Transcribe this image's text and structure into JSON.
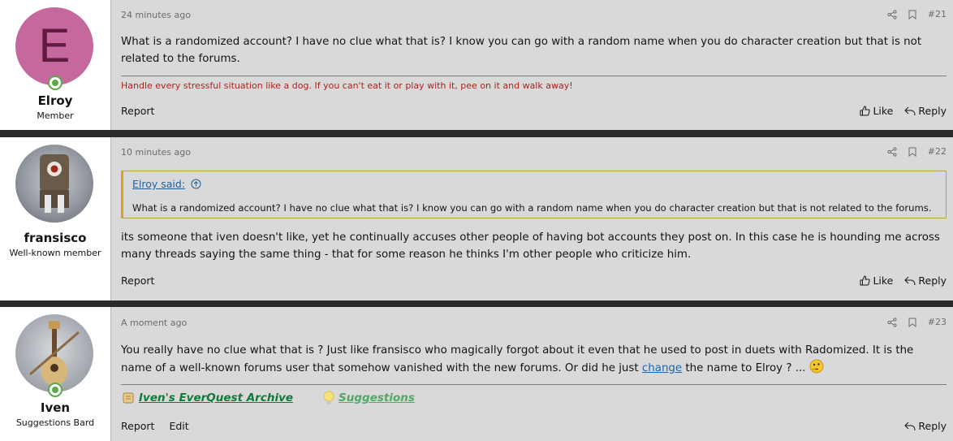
{
  "posts": [
    {
      "author": "Elroy",
      "author_title": "Member",
      "avatar_letter": "E",
      "time": "24 minutes ago",
      "number": "#21",
      "message": "What is a randomized account? I have no clue what that is? I know you can go with a random name when you do character creation but that is not related to the forums.",
      "signature": "Handle every stressful situation like a dog. If you can't eat it or play with it, pee on it and walk away!",
      "actions": {
        "report": "Report",
        "like": "Like",
        "reply": "Reply"
      }
    },
    {
      "author": "fransisco",
      "author_title": "Well-known member",
      "time": "10 minutes ago",
      "number": "#22",
      "quote_author": "Elroy said:",
      "quote_text": "What is a randomized account? I have no clue what that is? I know you can go with a random name when you do character creation but that is not related to the forums.",
      "message": "its someone that iven doesn't like, yet he continually accuses other people of having bot accounts they post on. In this case he is hounding me across many threads saying the same thing - that for some reason he thinks I'm other people who criticize him.",
      "actions": {
        "report": "Report",
        "like": "Like",
        "reply": "Reply"
      }
    },
    {
      "author": "Iven",
      "author_title": "Suggestions Bard",
      "time": "A moment ago",
      "number": "#23",
      "message_before_link": "You really have no clue what that is ? Just like fransisco who magically forgot about it even that he used to post in duets with Radomized. It is the name of a well-known forums user that somehow vanished with the new forums. Or did he just ",
      "message_link": "change",
      "message_after_link": " the name to Elroy ? ... ",
      "signature_links": [
        "Iven's EverQuest Archive",
        "Suggestions"
      ],
      "actions": {
        "report": "Report",
        "edit": "Edit",
        "reply": "Reply"
      }
    }
  ],
  "icons": {
    "share": "share-icon",
    "bookmark": "bookmark-icon",
    "like": "thumbs-up-icon",
    "reply": "reply-icon",
    "online": "online-status-icon",
    "quote_jump": "arrow-up-circle-icon",
    "thinking_emoji": "thinking-face-icon",
    "scroll": "scroll-icon",
    "bulb": "light-bulb-icon"
  },
  "colors": {
    "post_bg": "#d9d9d9",
    "signature_red": "#b0211b",
    "link_blue": "#1a66b5",
    "online_green": "#5da84b",
    "archive_green": "#0f7a3a",
    "suggestions_green": "#52a865",
    "quote_border": "#d9a321"
  }
}
